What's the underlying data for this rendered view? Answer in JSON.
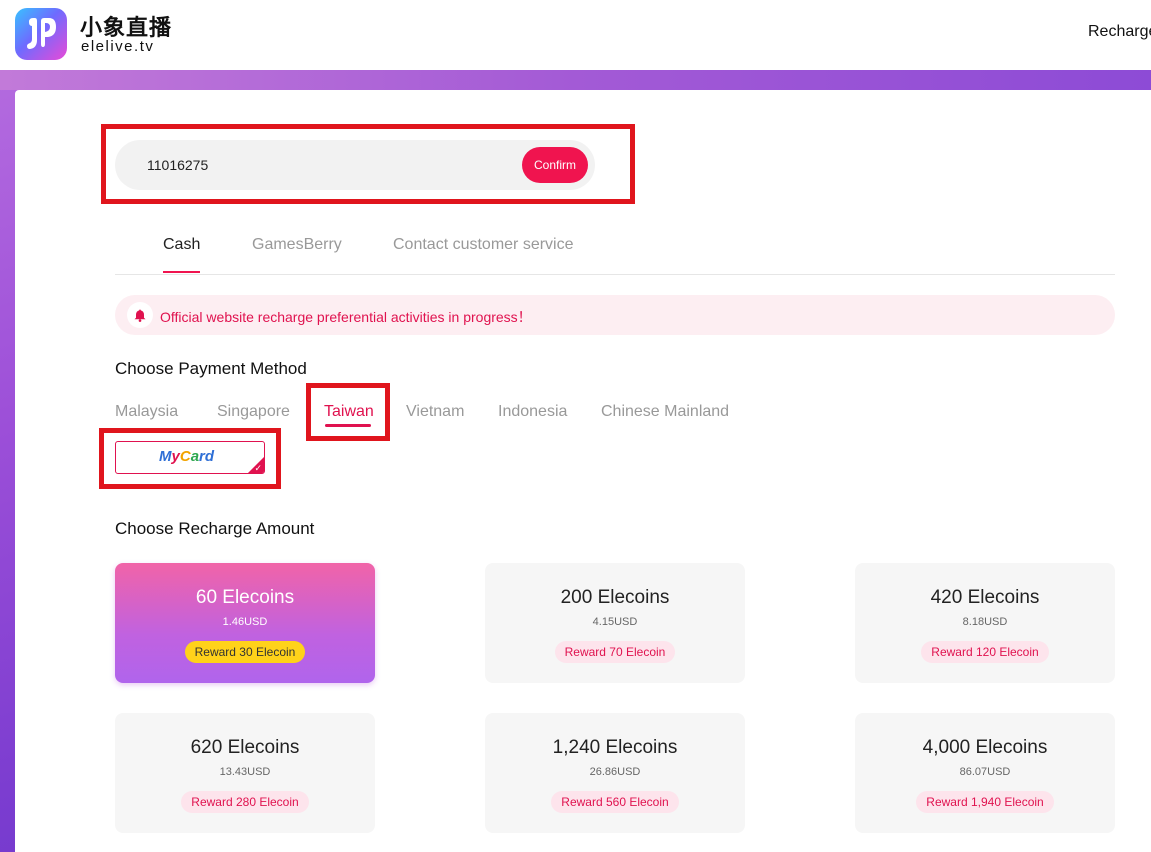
{
  "header": {
    "brand_cn": "小象直播",
    "brand_en": "elelive.tv",
    "nav_recharge": "Recharge"
  },
  "user_id_input": {
    "value": "11016275",
    "confirm_label": "Confirm"
  },
  "tabs": [
    {
      "label": "Cash",
      "active": true
    },
    {
      "label": "GamesBerry",
      "active": false
    },
    {
      "label": "Contact customer service",
      "active": false
    }
  ],
  "notice": {
    "icon": "bell-icon",
    "text": "Official website recharge preferential activities in progress！"
  },
  "payment": {
    "title": "Choose Payment Method",
    "regions": [
      {
        "label": "Malaysia",
        "active": false
      },
      {
        "label": "Singapore",
        "active": false
      },
      {
        "label": "Taiwan",
        "active": true
      },
      {
        "label": "Vietnam",
        "active": false
      },
      {
        "label": "Indonesia",
        "active": false
      },
      {
        "label": "Chinese Mainland",
        "active": false
      }
    ],
    "method": {
      "name": "MyCard",
      "selected": true
    }
  },
  "recharge": {
    "title": "Choose Recharge Amount",
    "options": [
      {
        "amount": "60 Elecoins",
        "price": "1.46USD",
        "reward": "Reward 30 Elecoin",
        "selected": true
      },
      {
        "amount": "200 Elecoins",
        "price": "4.15USD",
        "reward": "Reward 70 Elecoin",
        "selected": false
      },
      {
        "amount": "420 Elecoins",
        "price": "8.18USD",
        "reward": "Reward 120 Elecoin",
        "selected": false
      },
      {
        "amount": "620 Elecoins",
        "price": "13.43USD",
        "reward": "Reward 280 Elecoin",
        "selected": false
      },
      {
        "amount": "1,240 Elecoins",
        "price": "26.86USD",
        "reward": "Reward 560 Elecoin",
        "selected": false
      },
      {
        "amount": "4,000 Elecoins",
        "price": "86.07USD",
        "reward": "Reward 1,940 Elecoin",
        "selected": false
      }
    ]
  },
  "colors": {
    "accent": "#e0124f",
    "confirm": "#f0144f",
    "annotation_box": "#e0151d",
    "reward_badge_selected": "#ffd21a"
  }
}
